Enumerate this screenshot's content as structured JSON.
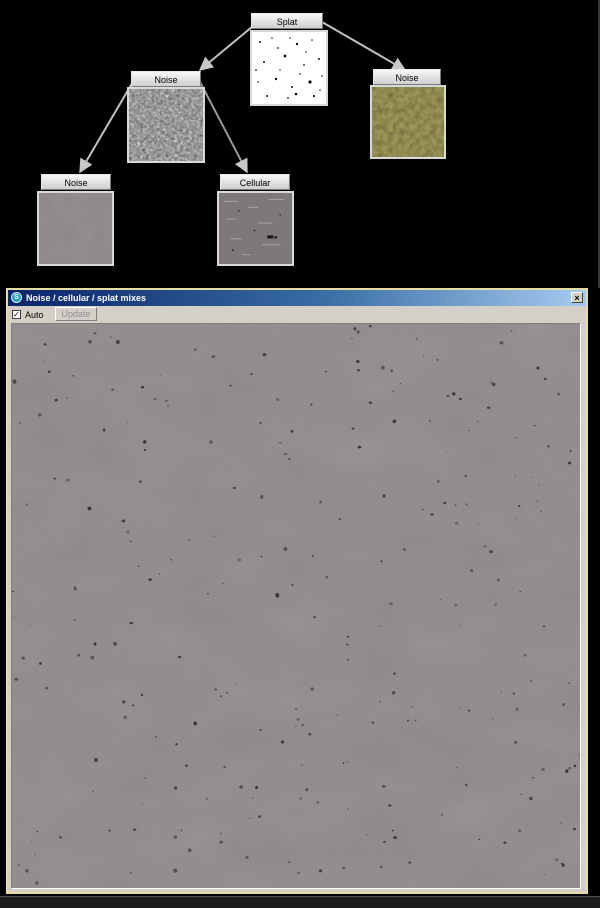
{
  "graph": {
    "nodes": {
      "splat": {
        "label": "Splat"
      },
      "noise_a": {
        "label": "Noise"
      },
      "noise_b": {
        "label": "Noise"
      },
      "noise_c": {
        "label": "Noise"
      },
      "cellular": {
        "label": "Cellular"
      }
    },
    "colors": {
      "background": "#000000",
      "wire": "#c0c0c0"
    }
  },
  "window": {
    "title": "Noise / cellular / splat mixes",
    "close_label": "×",
    "app_icon_glyph": "S",
    "toolbar": {
      "auto_label": "Auto",
      "auto_checked_mark": "✓",
      "update_label": "Update"
    },
    "colors": {
      "title_start": "#0a246a",
      "title_end": "#a6caf0",
      "texture_base": "#8e898b",
      "border": "#e6dba0"
    }
  }
}
